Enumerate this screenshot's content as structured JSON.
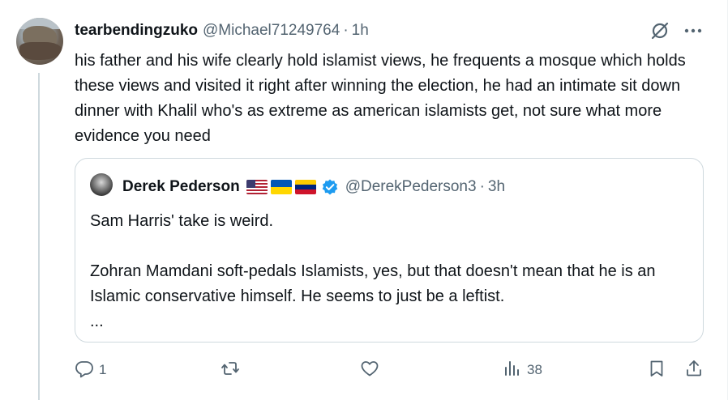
{
  "tweet": {
    "display_name": "tearbendingzuko",
    "handle": "@Michael71249764",
    "separator": "·",
    "time": "1h",
    "text": "his father and his wife clearly hold islamist views, he frequents a mosque which holds these views and visited it right after winning the election, he had an intimate sit down dinner with Khalil who's as extreme as american islamists get, not sure what more evidence you need"
  },
  "quote": {
    "display_name": "Derek Pederson",
    "flags": [
      "us-flag",
      "ukraine-flag",
      "venezuela-flag"
    ],
    "handle": "@DerekPederson3",
    "separator": "·",
    "time": "3h",
    "line1": "Sam Harris' take is weird.",
    "line2": "Zohran Mamdani soft-pedals Islamists, yes, but that doesn't mean that he is an Islamic conservative himself. He seems to just be a leftist.",
    "line3": "..."
  },
  "actions": {
    "reply_count": "1",
    "retweet_count": "",
    "like_count": "",
    "views_count": "38"
  },
  "colors": {
    "text": "#0f1419",
    "secondary": "#536471",
    "border": "#cfd9de",
    "verified": "#1d9bf0"
  }
}
